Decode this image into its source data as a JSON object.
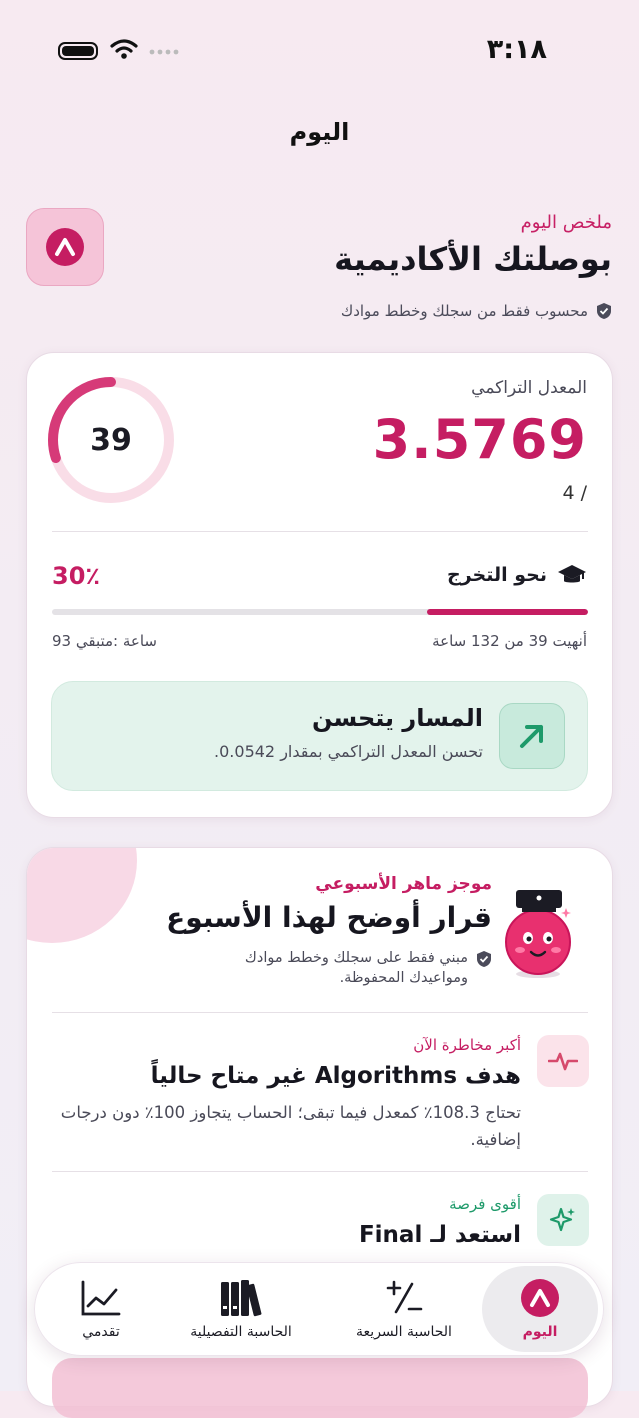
{
  "status_bar": {
    "time": "٣:١٨"
  },
  "nav": {
    "title": "اليوم"
  },
  "header": {
    "eyebrow": "ملخص اليوم",
    "title": "بوصلتك الأكاديمية",
    "note": "محسوب فقط من سجلك وخطط موادك"
  },
  "gpa_card": {
    "label": "المعدل التراكمي",
    "value": "3.5769",
    "scale": "4 /",
    "ring_value": "39",
    "graduation": {
      "label": "نحو التخرج",
      "percent_text": "30٪",
      "progress_fraction": 0.3,
      "completed_text": "أنهيت 39 من 132 ساعة",
      "remaining_text": "93 ساعة :متبقي"
    },
    "trend": {
      "title": "المسار يتحسن",
      "subtitle": "تحسن المعدل التراكمي بمقدار 0.0542."
    }
  },
  "brief_card": {
    "eyebrow": "موجز ماهر الأسبوعي",
    "title": "قرار أوضح لهذا الأسبوع",
    "note": "مبني فقط على سجلك وخطط موادك ومواعيدك المحفوظة.",
    "risk": {
      "eyebrow": "أكبر مخاطرة الآن",
      "title": "هدف Algorithms غير متاح حالياً",
      "body": "تحتاج 108.3٪ كمعدل فيما تبقى؛ الحساب يتجاوز 100٪ دون درجات إضافية."
    },
    "opportunity": {
      "eyebrow": "أقوى فرصة",
      "title": "استعد لـ Final"
    }
  },
  "tabbar": {
    "today": "اليوم",
    "quick_calc": "الحاسبة السريعة",
    "detailed_calc": "الحاسبة التفصيلية",
    "progress": "تقدمي"
  },
  "colors": {
    "accent": "#c51d62",
    "success": "#1e9a6a"
  }
}
